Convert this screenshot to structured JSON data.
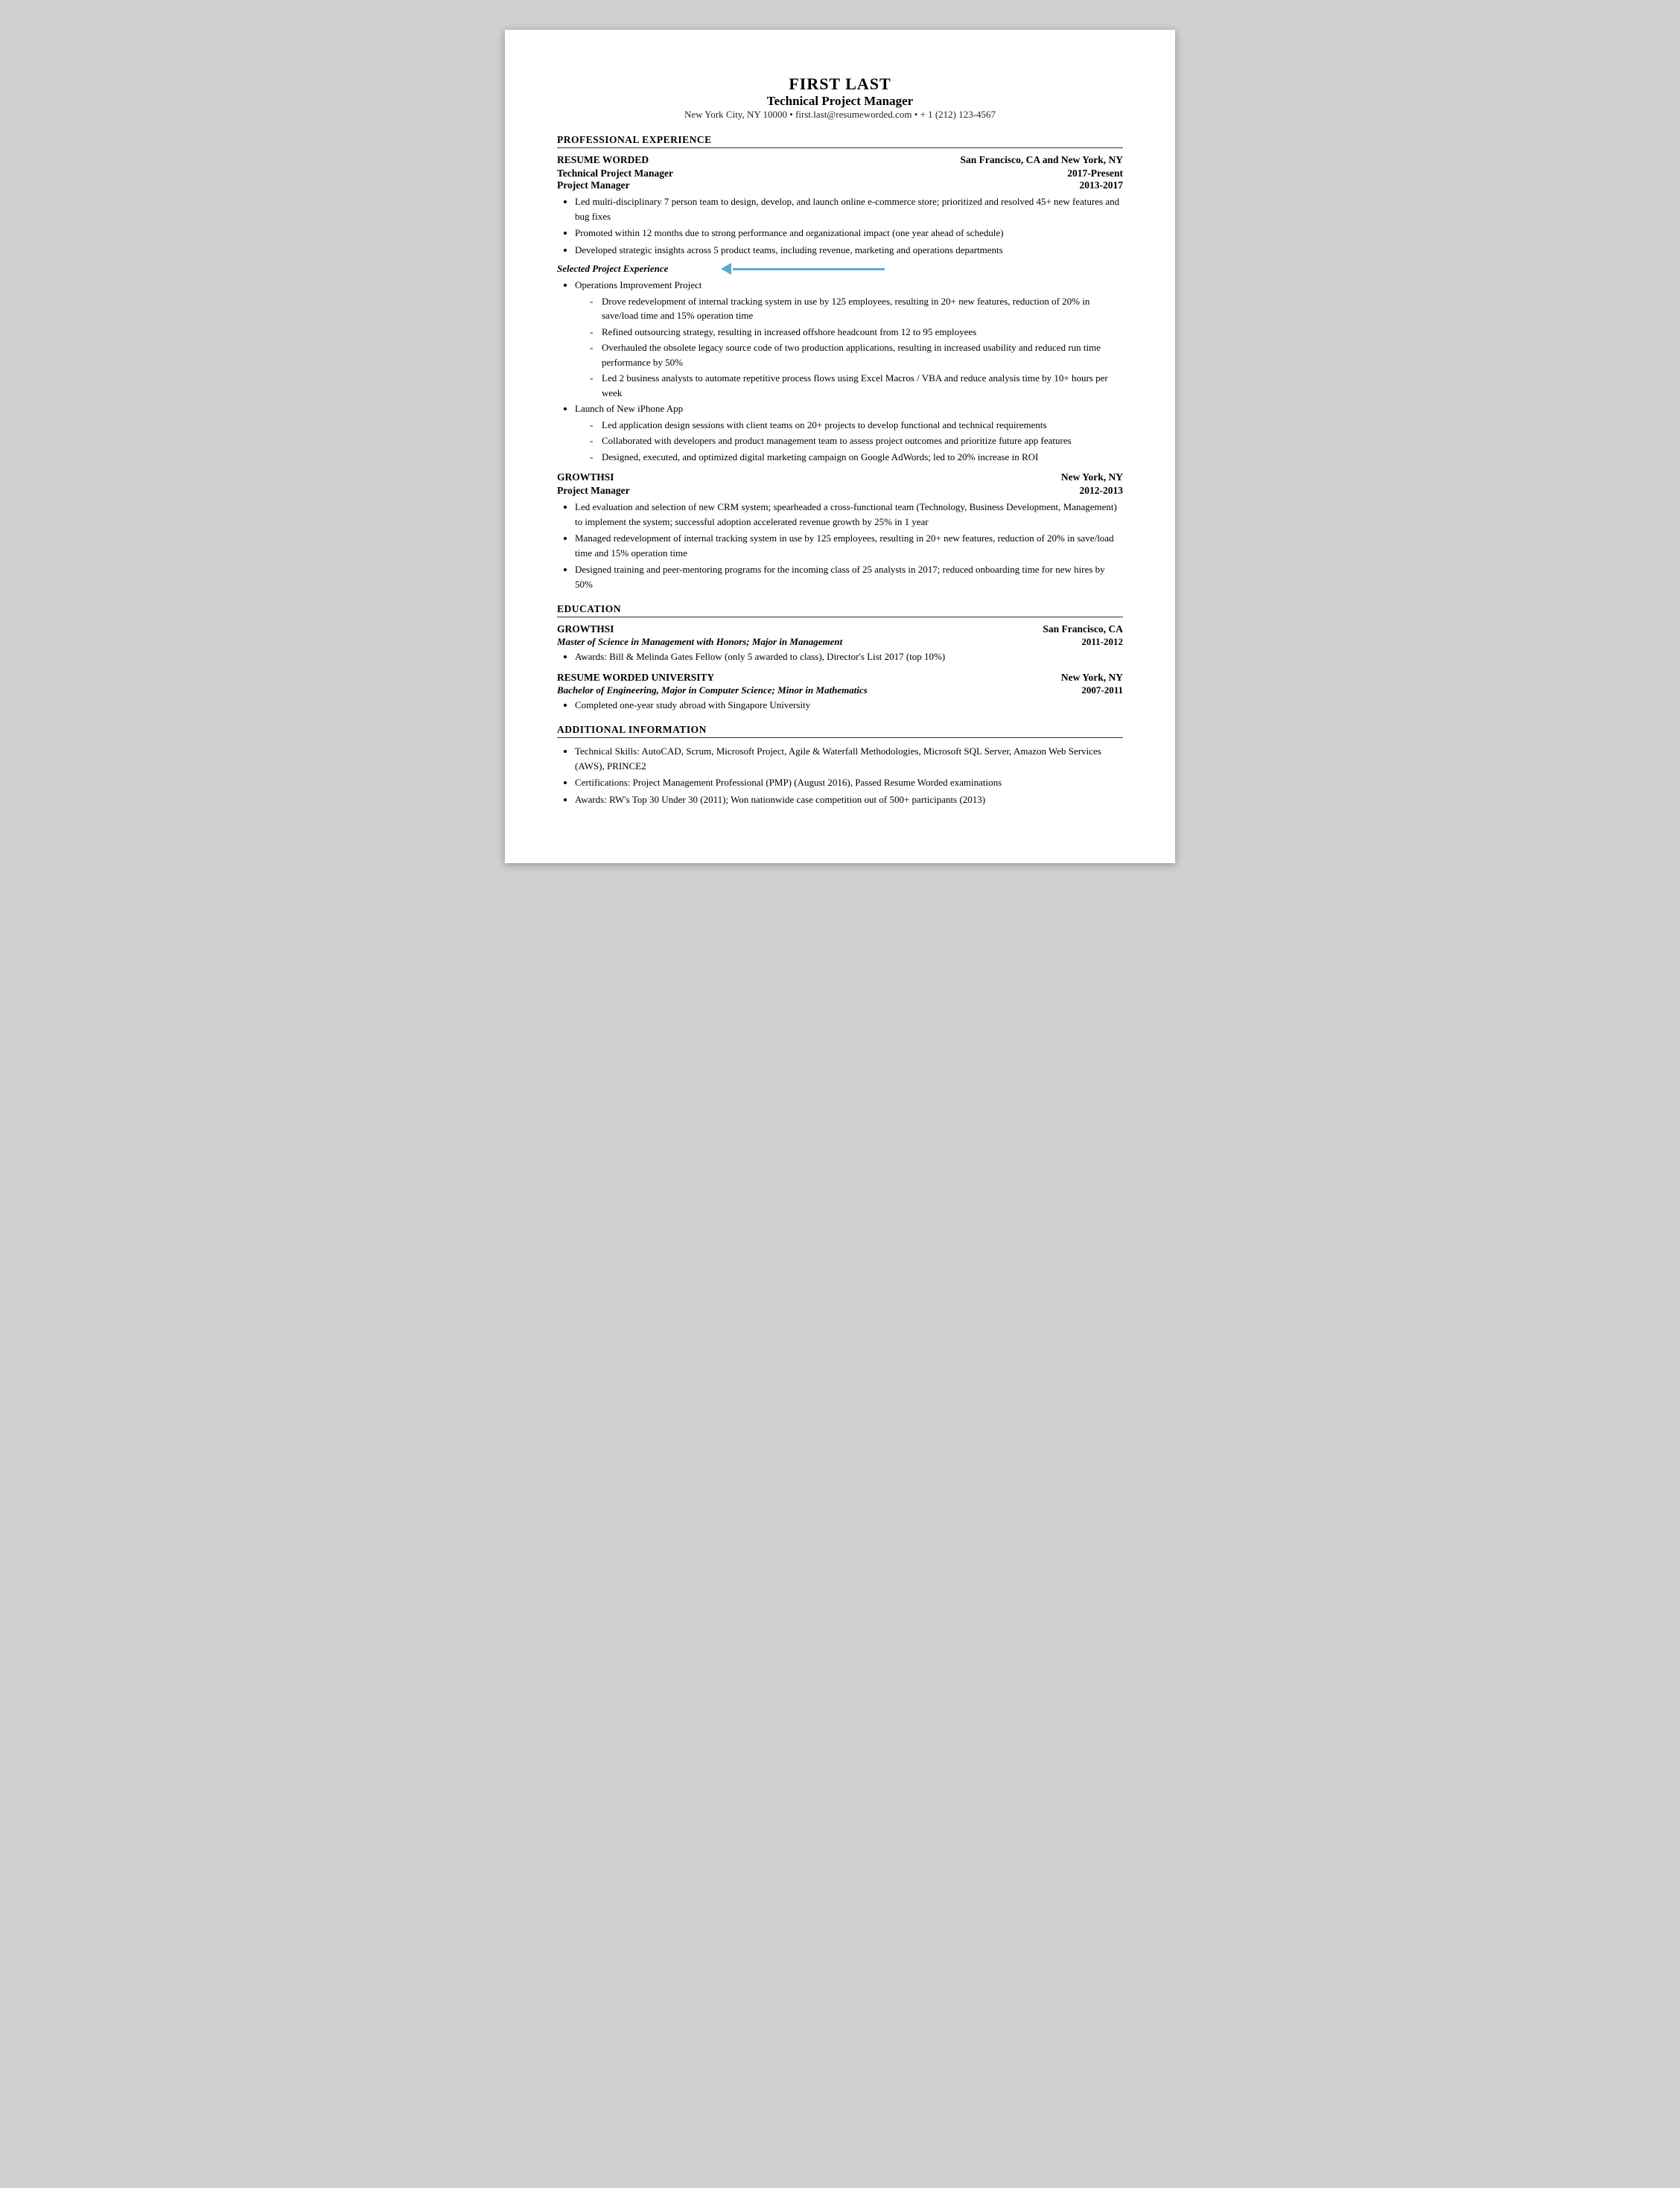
{
  "header": {
    "name": "FIRST LAST",
    "title": "Technical Project Manager",
    "contact": "New York City, NY 10000 • first.last@resumeworded.com • + 1 (212) 123-4567"
  },
  "sections": {
    "professional_experience": {
      "label": "PROFESSIONAL EXPERIENCE",
      "jobs": [
        {
          "company": "RESUME WORDED",
          "location": "San Francisco, CA and New York, NY",
          "titles": [
            {
              "title": "Technical Project Manager",
              "date": "2017-Present"
            },
            {
              "title": "Project Manager",
              "date": "2013-2017"
            }
          ],
          "bullets": [
            "Led multi-disciplinary 7 person team to design, develop, and launch online e-commerce store; prioritized and resolved 45+ new features and bug fixes",
            "Promoted within 12 months due to strong performance and organizational impact (one year ahead of schedule)",
            "Developed strategic insights across 5 product teams, including revenue, marketing and operations departments"
          ],
          "selected_projects": {
            "label": "Selected Project Experience",
            "projects": [
              {
                "name": "Operations Improvement Project",
                "bullets": [
                  "Drove redevelopment of internal tracking system in use by 125 employees, resulting in 20+ new features, reduction of 20% in save/load time and 15% operation time",
                  "Refined outsourcing strategy, resulting in increased offshore headcount from 12 to 95 employees",
                  "Overhauled the obsolete legacy source code of two production applications, resulting in increased usability and reduced run time performance by 50%",
                  "Led 2 business analysts to automate repetitive process flows using Excel Macros / VBA and reduce analysis time by 10+ hours per week"
                ]
              },
              {
                "name": "Launch of New iPhone App",
                "bullets": [
                  "Led application design sessions with client teams on 20+ projects to develop functional and technical requirements",
                  "Collaborated with developers and product management team to assess project outcomes and prioritize future app features",
                  "Designed, executed, and optimized digital marketing campaign on Google AdWords; led to 20% increase in ROI"
                ]
              }
            ]
          }
        },
        {
          "company": "GROWTHSI",
          "location": "New York, NY",
          "titles": [
            {
              "title": "Project Manager",
              "date": "2012-2013"
            }
          ],
          "bullets": [
            "Led evaluation and selection of new CRM system; spearheaded a cross-functional team (Technology, Business Development, Management) to implement the system; successful adoption accelerated revenue growth by 25% in 1 year",
            "Managed redevelopment of internal tracking system in use by 125 employees, resulting in 20+ new features, reduction of 20% in save/load time and 15% operation time",
            "Designed training and peer-mentoring programs for the incoming class of 25 analysts in 2017; reduced onboarding time for new hires by 50%"
          ]
        }
      ]
    },
    "education": {
      "label": "EDUCATION",
      "schools": [
        {
          "name": "GROWTHSI",
          "location": "San Francisco, CA",
          "degree": "Master of Science in Management with Honors; Major in Management",
          "dates": "2011-2012",
          "bullets": [
            "Awards: Bill & Melinda Gates Fellow (only 5 awarded to class), Director's List 2017 (top 10%)"
          ]
        },
        {
          "name": "RESUME WORDED UNIVERSITY",
          "location": "New York, NY",
          "degree": "Bachelor of Engineering, Major in Computer Science; Minor in Mathematics",
          "dates": "2007-2011",
          "bullets": [
            "Completed one-year study abroad with Singapore University"
          ]
        }
      ]
    },
    "additional_information": {
      "label": "ADDITIONAL INFORMATION",
      "bullets": [
        "Technical Skills: AutoCAD, Scrum, Microsoft Project, Agile & Waterfall Methodologies, Microsoft SQL Server, Amazon Web Services (AWS), PRINCE2",
        "Certifications: Project Management Professional (PMP) (August 2016), Passed Resume Worded examinations",
        "Awards: RW's Top 30 Under 30 (2011); Won nationwide case competition out of 500+ participants (2013)"
      ]
    }
  }
}
